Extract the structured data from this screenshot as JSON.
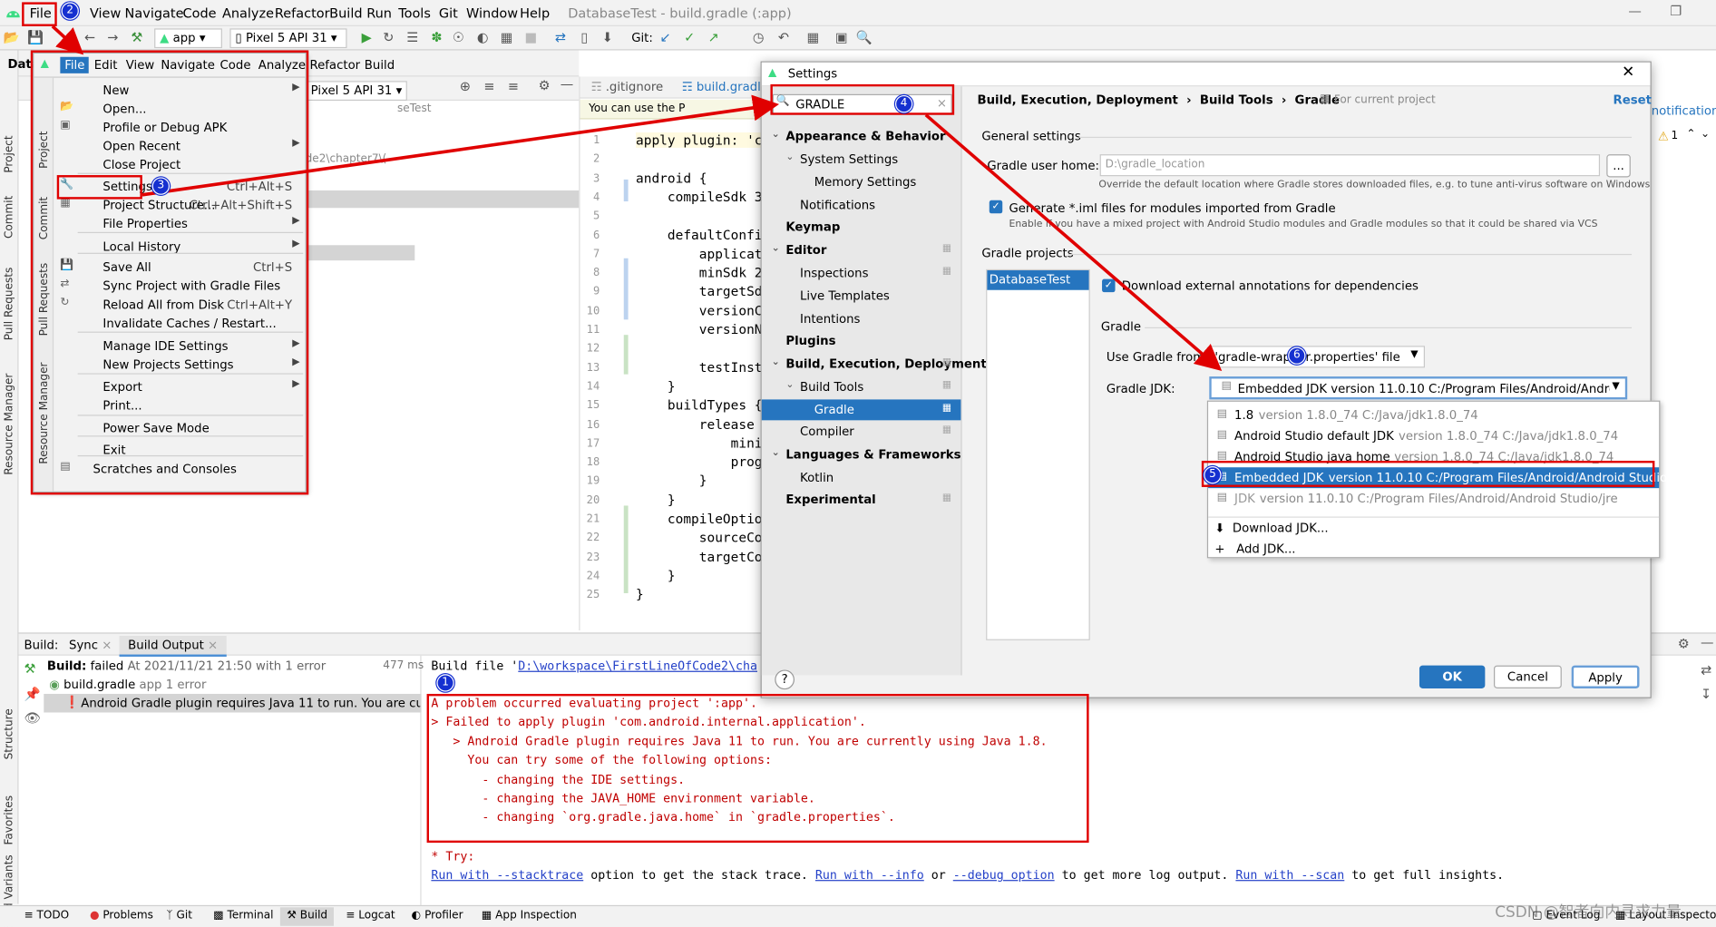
{
  "menubar": {
    "items": [
      "File",
      "Edit",
      "View",
      "Navigate",
      "Code",
      "Analyze",
      "Refactor",
      "Build",
      "Run",
      "Tools",
      "Git",
      "Window",
      "Help"
    ],
    "title": "DatabaseTest - build.gradle (:app)"
  },
  "toolbar": {
    "module": "app",
    "device": "Pixel 5 API 31",
    "git_label": "Git:"
  },
  "project_panel": {
    "crumb": "Data",
    "device_combo": "Pixel 5 API 31",
    "path_fragment1": "seTest",
    "path_fragment2": "de2\\chapter7\\("
  },
  "editor": {
    "tabs": [
      ".gitignore",
      "build.gradl"
    ],
    "banner": "You can use the P",
    "line_numbers": [
      "1",
      "2",
      "3",
      "4",
      "5",
      "6",
      "7",
      "8",
      "9",
      "10",
      "11",
      "12",
      "13",
      "14",
      "15",
      "16",
      "17",
      "18",
      "19",
      "20",
      "21",
      "22",
      "23",
      "24",
      "25"
    ],
    "lines": [
      "apply plugin: 'co",
      "",
      "android {",
      "    compileSdk 30",
      "",
      "    defaultConfig",
      "        applicati",
      "        minSdk 26",
      "        targetSdk",
      "        versionCo",
      "        versionNa",
      "",
      "        testInstr",
      "    }",
      "    buildTypes {",
      "        release {",
      "            minif",
      "            progu",
      "        }",
      "    }",
      "    compileOption",
      "        sourceCom",
      "        targetCom",
      "    }",
      "}"
    ]
  },
  "right_edge": {
    "notification": "notification",
    "warn": "1"
  },
  "left_strip": [
    "Project",
    "Commit",
    "Pull Requests",
    "Resource Manager",
    "Structure",
    "Favorites",
    "Build Variants"
  ],
  "file_menu": {
    "header": [
      "File",
      "Edit",
      "View",
      "Navigate",
      "Code",
      "Analyze",
      "Refactor",
      "Build"
    ],
    "side_tabs": [
      "Project",
      "Commit",
      "Pull Requests",
      "Resource Manager"
    ],
    "items": [
      {
        "label": "New",
        "shortcut": "",
        "sub": true
      },
      {
        "label": "Open...",
        "shortcut": "",
        "sub": false
      },
      {
        "label": "Profile or Debug APK",
        "shortcut": "",
        "sub": false
      },
      {
        "label": "Open Recent",
        "shortcut": "",
        "sub": true
      },
      {
        "label": "Close Project",
        "shortcut": "",
        "sub": false
      },
      {
        "label": "Settings...",
        "shortcut": "Ctrl+Alt+S",
        "sub": false
      },
      {
        "label": "Project Structure...",
        "shortcut": "Ctrl+Alt+Shift+S",
        "sub": false
      },
      {
        "label": "File Properties",
        "shortcut": "",
        "sub": true
      },
      {
        "label": "Local History",
        "shortcut": "",
        "sub": true
      },
      {
        "label": "Save All",
        "shortcut": "Ctrl+S",
        "sub": false
      },
      {
        "label": "Sync Project with Gradle Files",
        "shortcut": "",
        "sub": false
      },
      {
        "label": "Reload All from Disk",
        "shortcut": "Ctrl+Alt+Y",
        "sub": false
      },
      {
        "label": "Invalidate Caches / Restart...",
        "shortcut": "",
        "sub": false
      },
      {
        "label": "Manage IDE Settings",
        "shortcut": "",
        "sub": true
      },
      {
        "label": "New Projects Settings",
        "shortcut": "",
        "sub": true
      },
      {
        "label": "Export",
        "shortcut": "",
        "sub": true
      },
      {
        "label": "Print...",
        "shortcut": "",
        "sub": false
      },
      {
        "label": "Power Save Mode",
        "shortcut": "",
        "sub": false
      },
      {
        "label": "Exit",
        "shortcut": "",
        "sub": false
      },
      {
        "label": "Scratches and Consoles",
        "shortcut": "",
        "sub": false
      }
    ]
  },
  "settings": {
    "title": "Settings",
    "search_value": "GRADLE",
    "breadcrumb": [
      "Build, Execution, Deployment",
      "Build Tools",
      "Gradle"
    ],
    "for_project": "For current project",
    "reset": "Reset",
    "tree": [
      {
        "label": "Appearance & Behavior",
        "bold": true,
        "arrow": "down"
      },
      {
        "label": "System Settings",
        "bold": false,
        "arrow": "down"
      },
      {
        "label": "Memory Settings",
        "bold": false,
        "arrow": ""
      },
      {
        "label": "Notifications",
        "bold": false,
        "arrow": ""
      },
      {
        "label": "Keymap",
        "bold": true,
        "arrow": ""
      },
      {
        "label": "Editor",
        "bold": true,
        "arrow": "down"
      },
      {
        "label": "Inspections",
        "bold": false,
        "arrow": ""
      },
      {
        "label": "Live Templates",
        "bold": false,
        "arrow": ""
      },
      {
        "label": "Intentions",
        "bold": false,
        "arrow": ""
      },
      {
        "label": "Plugins",
        "bold": true,
        "arrow": ""
      },
      {
        "label": "Build, Execution, Deployment",
        "bold": true,
        "arrow": "down"
      },
      {
        "label": "Build Tools",
        "bold": false,
        "arrow": "down"
      },
      {
        "label": "Gradle",
        "bold": false,
        "arrow": ""
      },
      {
        "label": "Compiler",
        "bold": false,
        "arrow": ""
      },
      {
        "label": "Languages & Frameworks",
        "bold": true,
        "arrow": "down"
      },
      {
        "label": "Kotlin",
        "bold": false,
        "arrow": ""
      },
      {
        "label": "Experimental",
        "bold": true,
        "arrow": ""
      }
    ],
    "general_title": "General settings",
    "user_home_label": "Gradle user home:",
    "user_home_value": "D:\\gradle_location",
    "browse": "...",
    "home_hint": "Override the default location where Gradle stores downloaded files, e.g. to tune anti-virus software on Windows",
    "iml_label": "Generate *.iml files for modules imported from Gradle",
    "iml_hint": "Enable if you have a mixed project with Android Studio modules and Gradle modules so that it could be shared via VCS",
    "projects_title": "Gradle projects",
    "project_item": "DatabaseTest",
    "download_label": "Download external annotations for dependencies",
    "gradle_title": "Gradle",
    "use_gradle_label": "Use Gradle from:",
    "use_gradle_value": "'gradle-wrapper.properties' file",
    "jdk_label": "Gradle JDK:",
    "jdk_value": "Embedded JDK version 11.0.10 C:/Program Files/Android/Android Stu",
    "jdk_options": [
      {
        "name": "1.8",
        "detail": "version 1.8.0_74 C:/Java/jdk1.8.0_74"
      },
      {
        "name": "Android Studio default JDK",
        "detail": "version 1.8.0_74 C:/Java/jdk1.8.0_74"
      },
      {
        "name": "Android Studio java home",
        "detail": "version 1.8.0_74 C:/Java/jdk1.8.0_74"
      },
      {
        "name": "Embedded JDK",
        "detail": "version 11.0.10 C:/Program Files/Android/Android Studio/jre"
      },
      {
        "name": "JDK",
        "detail": "version 11.0.10 C:/Program Files/Android/Android Studio/jre"
      }
    ],
    "download_jdk": "Download JDK...",
    "add_jdk": "Add JDK...",
    "help": "?",
    "ok": "OK",
    "cancel": "Cancel",
    "apply": "Apply"
  },
  "build_panel": {
    "tabs": [
      "Build:",
      "Sync",
      "Build Output"
    ],
    "status_label": "Build:",
    "status_text": "failed",
    "status_detail": "At 2021/11/21 21:50 with 1 error",
    "status_time": "477 ms",
    "file_item": "build.gradle",
    "file_detail": "app 1 error",
    "error_item": "Android Gradle plugin requires Java 11 to run. You are currently",
    "output_prefix": "Build file '",
    "output_path": "D:\\workspace\\FirstLineOfCode2\\cha",
    "error_lines": [
      "A problem occurred evaluating project ':app'.",
      "> Failed to apply plugin 'com.android.internal.application'.",
      "   > Android Gradle plugin requires Java 11 to run. You are currently using Java 1.8.",
      "     You can try some of the following options:",
      "       - changing the IDE settings.",
      "       - changing the JAVA_HOME environment variable.",
      "       - changing `org.gradle.java.home` in `gradle.properties`."
    ],
    "try_line": "* Try:",
    "try_parts": [
      "Run with --stacktrace",
      " option to get the stack trace. ",
      "Run with --info",
      " or ",
      "--debug option",
      " to get more log output. ",
      "Run with --scan",
      " to get full insights."
    ]
  },
  "bottom_bar": [
    "TODO",
    "Problems",
    "Git",
    "Terminal",
    "Build",
    "Logcat",
    "Profiler",
    "App Inspection",
    "Event Log",
    "Layout Inspector"
  ],
  "watermark": "CSDN @智者向内寻求力量",
  "markers": [
    "1",
    "2",
    "3",
    "4",
    "5",
    "6"
  ],
  "colors": {
    "accent": "#2675bf",
    "annotation": "#e00000",
    "badge": "#1530d0"
  }
}
